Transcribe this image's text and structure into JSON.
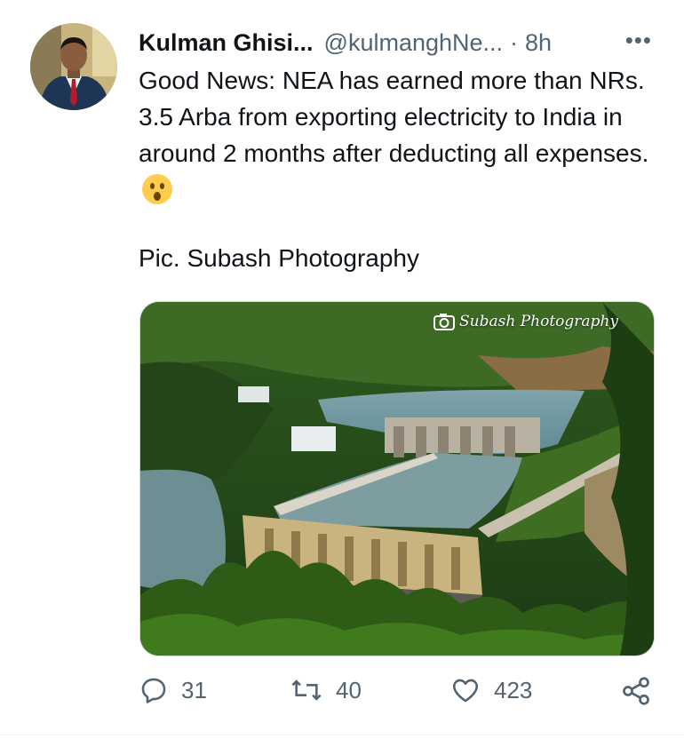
{
  "tweet": {
    "author_name": "Kulman Ghisi...",
    "author_handle": "@kulmanghNe...",
    "separator": "·",
    "time": "8h",
    "more_label": "•••",
    "text": "Good News: NEA has earned more than NRs. 3.5 Arba from exporting electricity to India in around 2 months after deducting all expenses.",
    "credit": "Pic. Subash Photography",
    "media_watermark": "Subash Photography"
  },
  "actions": {
    "replies": "31",
    "retweets": "40",
    "likes": "423"
  },
  "colors": {
    "text": "#0f1419",
    "secondary": "#536471",
    "emoji": "#ffcc4d"
  },
  "icons": [
    "more-icon",
    "reply-icon",
    "retweet-icon",
    "like-icon",
    "share-icon",
    "astonished-emoji-icon",
    "camera-icon"
  ]
}
